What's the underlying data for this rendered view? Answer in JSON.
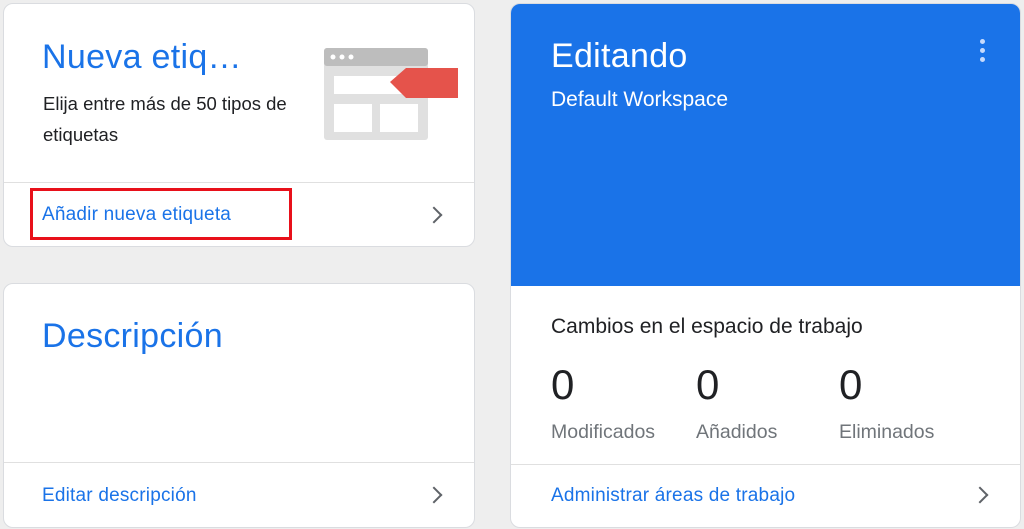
{
  "new_tag_card": {
    "title": "Nueva etiq…",
    "subtitle": "Elija entre más de 50 tipos de etiquetas",
    "link": "Añadir nueva etiqueta"
  },
  "description_card": {
    "title": "Descripción",
    "link": "Editar descripción"
  },
  "workspace_card": {
    "title": "Editando",
    "workspace_name": "Default Workspace",
    "changes_title": "Cambios en el espacio de trabajo",
    "stats": [
      {
        "value": "0",
        "label": "Modificados"
      },
      {
        "value": "0",
        "label": "Añadidos"
      },
      {
        "value": "0",
        "label": "Eliminados"
      }
    ],
    "link": "Administrar áreas de trabajo"
  },
  "colors": {
    "accent": "#1a73e8",
    "highlight": "#e8101a",
    "tag_red": "#e5534b"
  }
}
